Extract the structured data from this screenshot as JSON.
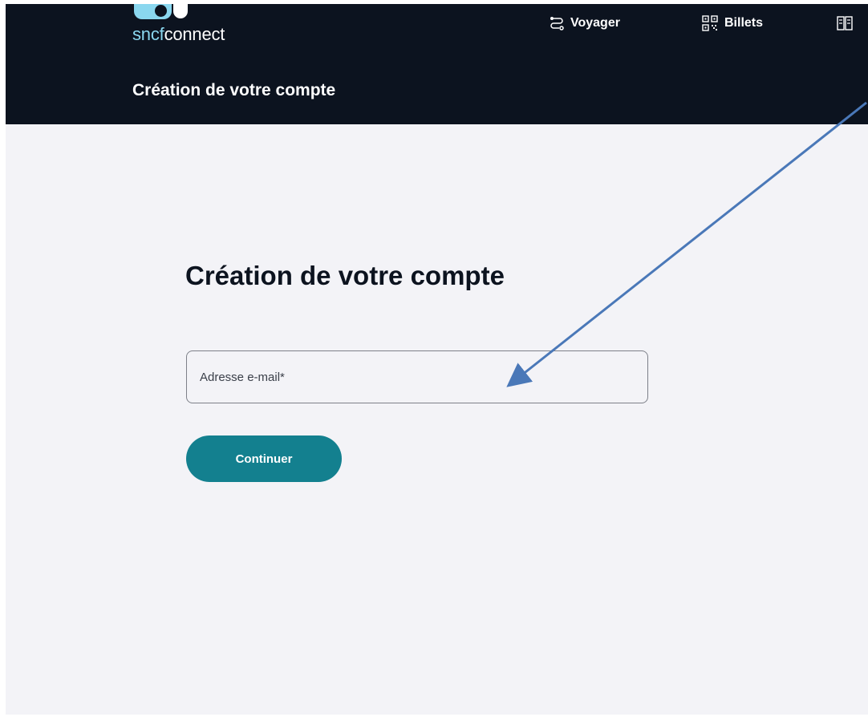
{
  "header": {
    "logo": {
      "part_a": "sncf",
      "part_b": "connect"
    },
    "nav": {
      "voyager": {
        "label": "Voyager",
        "icon": "route-icon"
      },
      "billets": {
        "label": "Billets",
        "icon": "qr-code-icon"
      },
      "more": {
        "icon": "book-icon"
      }
    },
    "title": "Création de votre compte"
  },
  "main": {
    "title": "Création de votre compte",
    "email": {
      "placeholder": "Adresse e-mail*",
      "value": ""
    },
    "continue_label": "Continuer"
  },
  "annotation": {
    "arrow_color": "#4a78b8"
  },
  "colors": {
    "header_bg": "#0c131f",
    "page_bg": "#f3f3f7",
    "accent": "#13808f",
    "logo_light": "#8ad7ef"
  }
}
